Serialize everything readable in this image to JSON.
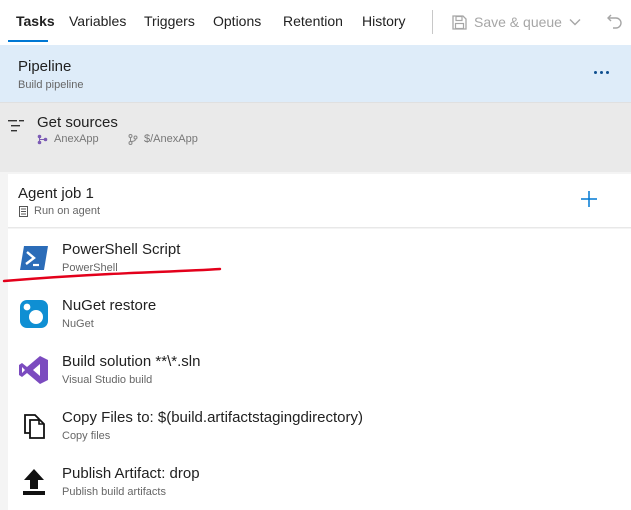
{
  "tabs": [
    {
      "label": "Tasks"
    },
    {
      "label": "Variables"
    },
    {
      "label": "Triggers"
    },
    {
      "label": "Options"
    },
    {
      "label": "Retention"
    },
    {
      "label": "History"
    }
  ],
  "toolbar": {
    "save_label": "Save & queue"
  },
  "pipeline": {
    "title": "Pipeline",
    "subtitle": "Build pipeline"
  },
  "sources": {
    "title": "Get sources",
    "repo": "AnexApp",
    "branch": "$/AnexApp"
  },
  "agent_job": {
    "title": "Agent job 1",
    "subtitle": "Run on agent"
  },
  "tasks": [
    {
      "title": "PowerShell Script",
      "subtitle": "PowerShell",
      "icon": "powershell-icon"
    },
    {
      "title": "NuGet restore",
      "subtitle": "NuGet",
      "icon": "nuget-icon"
    },
    {
      "title": "Build solution **\\*.sln",
      "subtitle": "Visual Studio build",
      "icon": "visual-studio-icon"
    },
    {
      "title": "Copy Files to: $(build.artifactstagingdirectory)",
      "subtitle": "Copy files",
      "icon": "copy-files-icon"
    },
    {
      "title": "Publish Artifact: drop",
      "subtitle": "Publish build artifacts",
      "icon": "publish-artifact-icon"
    }
  ],
  "colors": {
    "accent": "#0078d4",
    "pipeline_bg": "#deecf9",
    "annotation": "#e3001b"
  }
}
